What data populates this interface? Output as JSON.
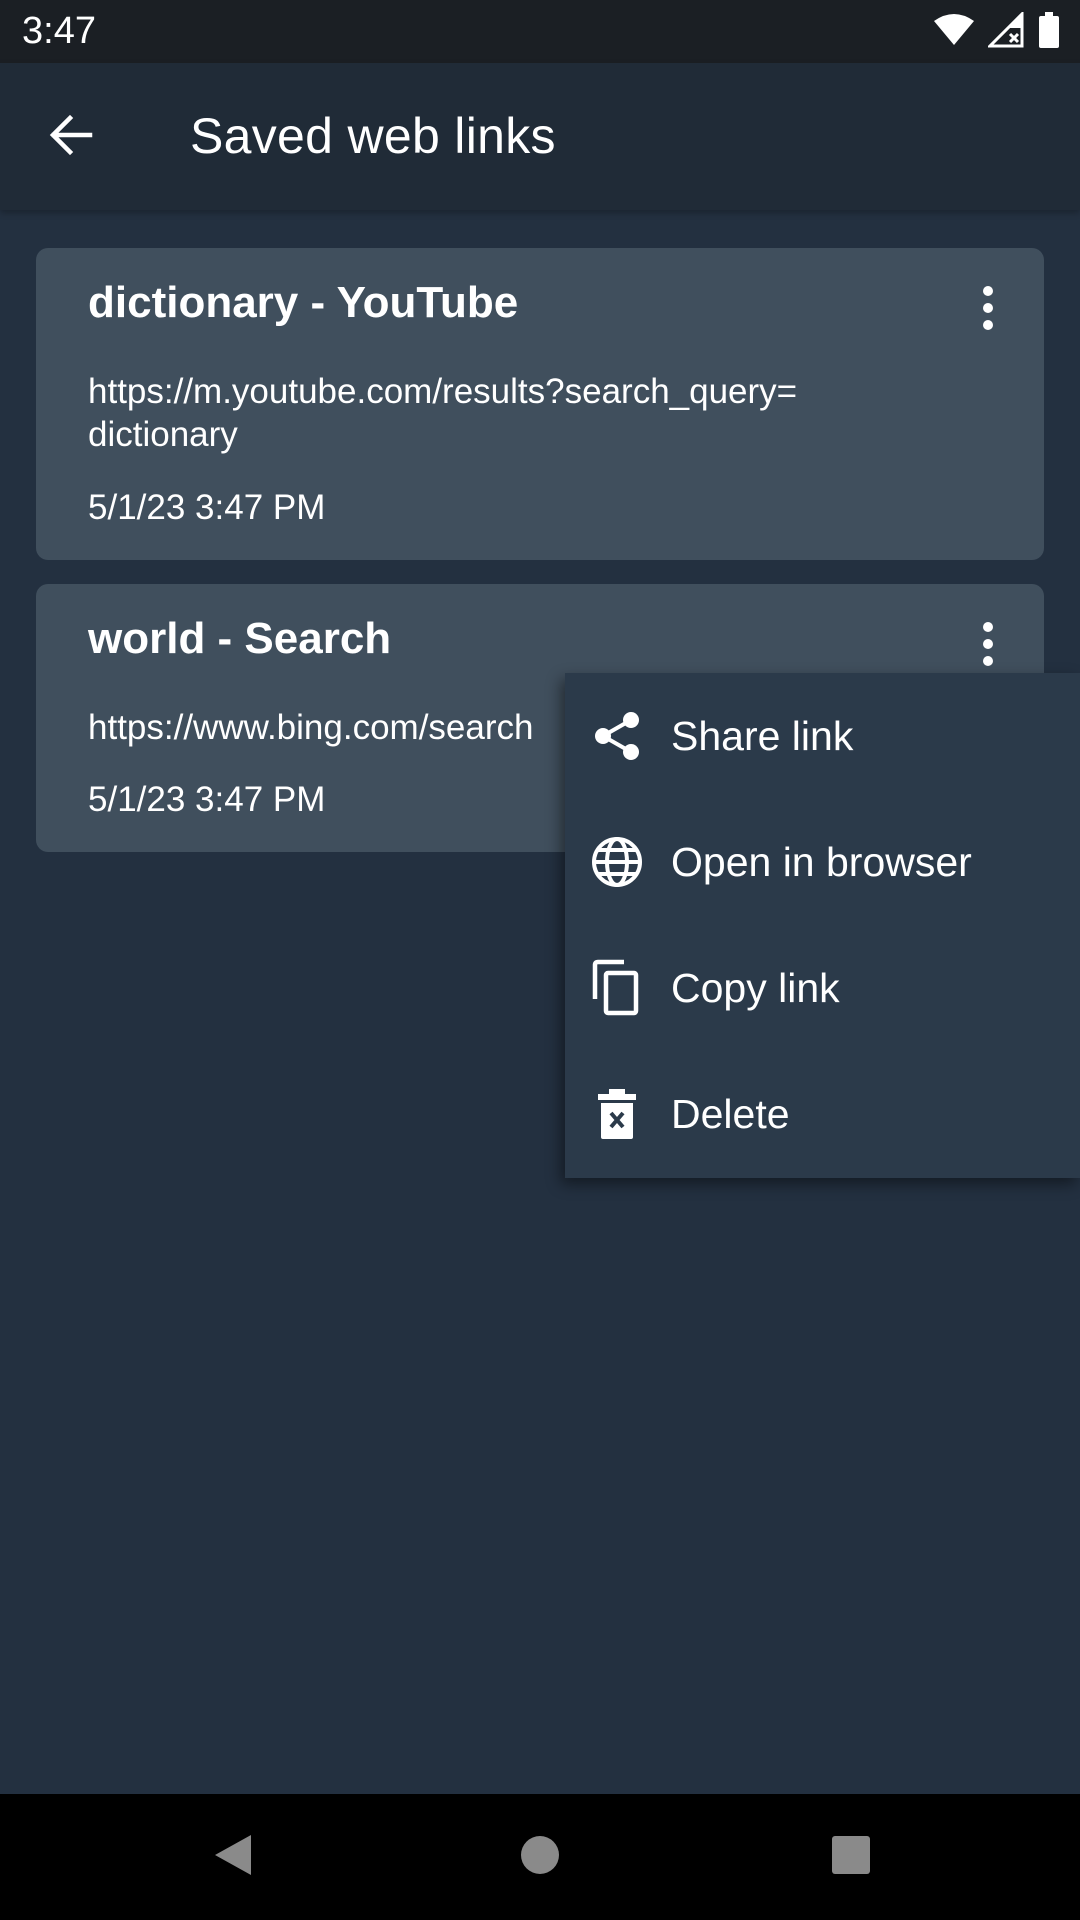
{
  "status_bar": {
    "time": "3:47",
    "icons": [
      "wifi-icon",
      "signal-icon",
      "battery-icon"
    ]
  },
  "app_bar": {
    "back_icon": "arrow-back-icon",
    "title": "Saved web links"
  },
  "links": [
    {
      "title": "dictionary - YouTube",
      "url_line1": "https://m.youtube.com/results?search_query=",
      "url_line2": "dictionary",
      "date": "5/1/23 3:47 PM"
    },
    {
      "title": "world - Search",
      "url_line1": "https://www.bing.com/search",
      "date": "5/1/23 3:47 PM"
    }
  ],
  "menu": {
    "items": [
      {
        "label": "Share link",
        "icon": "share-icon"
      },
      {
        "label": "Open in browser",
        "icon": "globe-icon"
      },
      {
        "label": "Copy link",
        "icon": "copy-icon"
      },
      {
        "label": "Delete",
        "icon": "delete-icon"
      }
    ]
  },
  "nav_bar": {
    "icons": [
      "back-triangle-icon",
      "home-circle-icon",
      "recents-square-icon"
    ]
  },
  "colors": {
    "background": "#233040",
    "app_bar": "#202b37",
    "card": "#404f5d",
    "menu": "#2b3a4a",
    "text": "#ffffff"
  }
}
